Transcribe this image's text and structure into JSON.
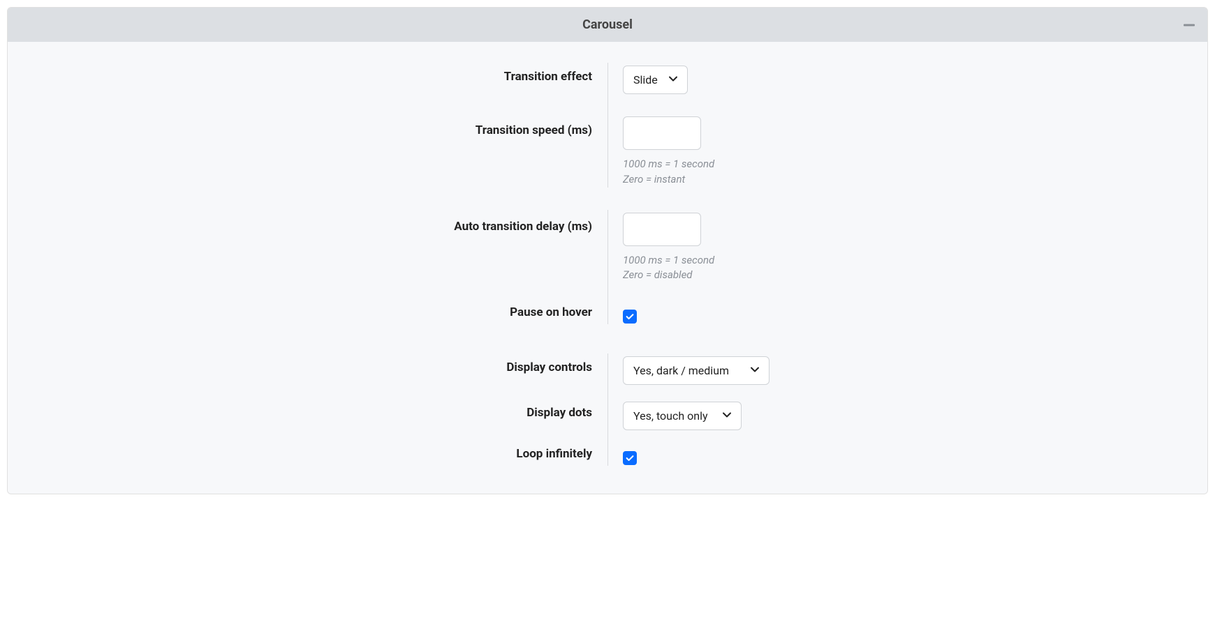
{
  "panel": {
    "title": "Carousel"
  },
  "fields": {
    "transition_effect": {
      "label": "Transition effect",
      "value": "Slide"
    },
    "transition_speed": {
      "label": "Transition speed (ms)",
      "value": "",
      "help_line1": "1000 ms = 1 second",
      "help_line2": "Zero = instant"
    },
    "auto_transition_delay": {
      "label": "Auto transition delay (ms)",
      "value": "",
      "help_line1": "1000 ms = 1 second",
      "help_line2": "Zero = disabled"
    },
    "pause_on_hover": {
      "label": "Pause on hover",
      "checked": true
    },
    "display_controls": {
      "label": "Display controls",
      "value": "Yes, dark / medium"
    },
    "display_dots": {
      "label": "Display dots",
      "value": "Yes, touch only"
    },
    "loop_infinitely": {
      "label": "Loop infinitely",
      "checked": true
    }
  }
}
